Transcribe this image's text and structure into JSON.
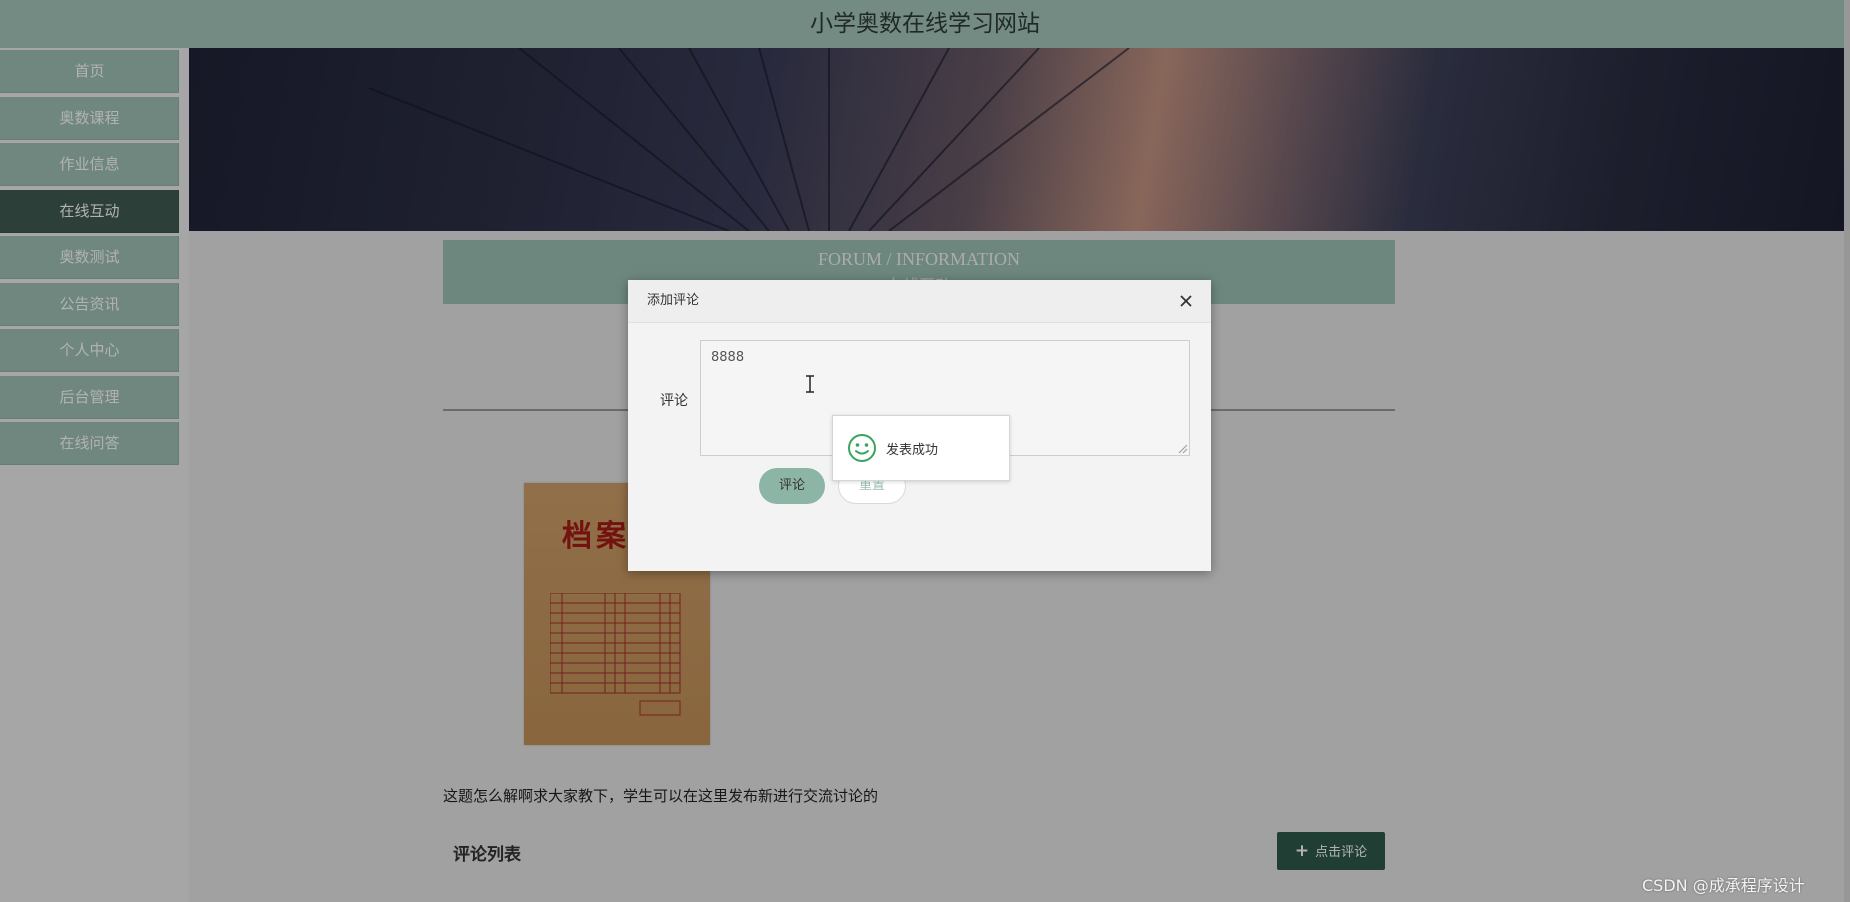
{
  "site": {
    "title": "小学奥数在线学习网站"
  },
  "nav": {
    "items": [
      {
        "label": "首页"
      },
      {
        "label": "奥数课程"
      },
      {
        "label": "作业信息"
      },
      {
        "label": "在线互动",
        "active": true
      },
      {
        "label": "奥数测试"
      },
      {
        "label": "公告资讯"
      },
      {
        "label": "个人中心"
      },
      {
        "label": "后台管理"
      },
      {
        "label": "在线问答"
      }
    ]
  },
  "section": {
    "title_en": "FORUM / INFORMATION",
    "title_cn": "在线互动"
  },
  "post": {
    "image_text": "档案",
    "description": "这题怎么解啊求大家教下，学生可以在这里发布新进行交流讨论的"
  },
  "comments": {
    "title": "评论列表",
    "add_button": "点击评论"
  },
  "dialog": {
    "title": "添加评论",
    "field_label": "评论",
    "textarea_value": "8888",
    "submit_label": "评论",
    "reset_label": "重置"
  },
  "toast": {
    "message": "发表成功"
  },
  "watermark": "CSDN @成承程序设计",
  "colors": {
    "header": "#a6c7be",
    "nav": "#9fc2b7",
    "nav_active": "#3f5b52",
    "accent_dark": "#2f5a4b"
  }
}
